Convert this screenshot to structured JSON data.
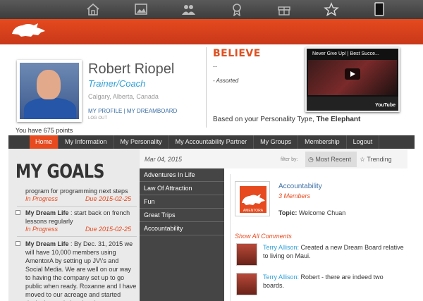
{
  "topbar": {
    "icons": [
      "home-icon",
      "photo-icon",
      "people-icon",
      "award-icon",
      "gift-icon",
      "star-icon",
      "tablet-icon"
    ]
  },
  "profile": {
    "name": "Robert Riopel",
    "role": "Trainer/Coach",
    "location": "Calgary, Alberta, Canada",
    "my_profile": "MY PROFILE",
    "my_dreamboard": "MY DREAMBOARD",
    "links_separator": "|",
    "log_out": "LOG OUT",
    "points": "You have 675 points"
  },
  "quote": {
    "title": "BELIEVE",
    "dash": "--",
    "author": "- Assorted",
    "personality_prefix": "Based on your Personality Type,",
    "personality_type": "The Elephant"
  },
  "video": {
    "title": "Never Give Up! | Best Succe...",
    "brand": "YouTube"
  },
  "nav": {
    "items": [
      "Home",
      "My Information",
      "My Personality",
      "My Accountability Partner",
      "My Groups",
      "Membership",
      "Logout"
    ]
  },
  "goals": {
    "title": "MY GOALS",
    "items": [
      {
        "text": "program for programming next steps",
        "status": "In Progress",
        "due": "Due 2015-02-25"
      },
      {
        "title": "My Dream Life",
        "text": " : start back on french lessons regularly",
        "status": "In Progress",
        "due": "Due 2015-02-25"
      },
      {
        "title": "My Dream Life",
        "text": " : By Dec. 31, 2015 we will have 10,000 members using AmentorA by setting up JV\\'s and Social Media. We are well on our way to having the company set up to go public when ready. Roxanne and I have moved to our acreage and started designing and planning the"
      }
    ]
  },
  "feed": {
    "date": "Mar 04, 2015",
    "filter_label": "filter by:",
    "tab_recent": "Most Recent",
    "tab_trending": "Trending",
    "categories": [
      "Adventures In Life",
      "Law Of Attraction",
      "Fun",
      "Great Trips",
      "Accountability"
    ],
    "group": {
      "name": "Accountability",
      "members": "3 Members",
      "topic_label": "Topic:",
      "topic": "Welcome Chuan",
      "logo_text": "AMENTORA"
    },
    "show_all": "Show All Comments",
    "comments": [
      {
        "author": "Terry Allison:",
        "text": "Created a new Dream Board relative to living on Maui."
      },
      {
        "author": "Terry Allison:",
        "text": "Robert - there are indeed two boards."
      }
    ]
  },
  "colors": {
    "accent": "#e64a1e",
    "link": "#33a0d8",
    "nav_bg": "#3d3d3d"
  }
}
